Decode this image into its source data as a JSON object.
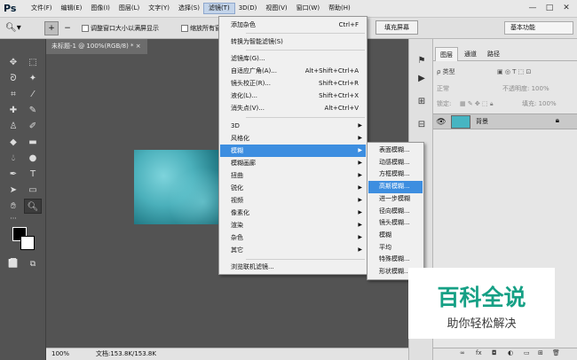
{
  "app": {
    "logo": "Ps"
  },
  "menubar": {
    "items": [
      "文件(F)",
      "编辑(E)",
      "图像(I)",
      "图层(L)",
      "文字(Y)",
      "选择(S)",
      "滤镜(T)",
      "3D(D)",
      "视图(V)",
      "窗口(W)",
      "帮助(H)"
    ],
    "active_item": "滤镜(T)"
  },
  "window_controls": {
    "minimize": "—",
    "maximize": "□",
    "close": "✕"
  },
  "options_bar": {
    "resize_windows_label": "调整窗口大小以满屏显示",
    "zoom_all_windows_label": "缩放所有窗口",
    "fill_screen_button": "填充屏幕",
    "workspace_value": "基本功能"
  },
  "document": {
    "tab_title": "未标题-1 @ 100%(RGB/8) *",
    "zoom_status": "100%",
    "doc_info": "文档:153.8K/153.8K"
  },
  "filter_menu": {
    "items": [
      {
        "label": "添加杂色",
        "shortcut": "Ctrl+F"
      },
      {
        "separator": true
      },
      {
        "label": "转换为智能滤镜(S)"
      },
      {
        "separator": true
      },
      {
        "label": "滤镜库(G)..."
      },
      {
        "label": "自适应广角(A)...",
        "shortcut": "Alt+Shift+Ctrl+A"
      },
      {
        "label": "镜头校正(R)...",
        "shortcut": "Shift+Ctrl+R"
      },
      {
        "label": "液化(L)...",
        "shortcut": "Shift+Ctrl+X"
      },
      {
        "label": "消失点(V)...",
        "shortcut": "Alt+Ctrl+V"
      },
      {
        "separator": true
      },
      {
        "label": "3D",
        "submenu": true
      },
      {
        "label": "风格化",
        "submenu": true
      },
      {
        "label": "模糊",
        "submenu": true,
        "highlighted": true
      },
      {
        "label": "模糊画廊",
        "submenu": true
      },
      {
        "label": "扭曲",
        "submenu": true
      },
      {
        "label": "锐化",
        "submenu": true
      },
      {
        "label": "视频",
        "submenu": true
      },
      {
        "label": "像素化",
        "submenu": true
      },
      {
        "label": "渲染",
        "submenu": true
      },
      {
        "label": "杂色",
        "submenu": true
      },
      {
        "label": "其它",
        "submenu": true
      },
      {
        "separator": true
      },
      {
        "label": "浏览联机滤镜..."
      }
    ]
  },
  "blur_submenu": {
    "items": [
      "表面模糊...",
      "动感模糊...",
      "方框模糊...",
      "高斯模糊...",
      "进一步模糊",
      "径向模糊...",
      "镜头模糊...",
      "模糊",
      "平均",
      "特殊模糊...",
      "形状模糊..."
    ],
    "highlighted_index": 3
  },
  "layers_panel": {
    "tabs": [
      "图层",
      "通道",
      "路径"
    ],
    "active_tab": "图层",
    "kind_filter": "ρ 类型",
    "blend_mode": "正常",
    "opacity_label": "不透明度: 100%",
    "lock_label": "锁定:",
    "fill_label": "填充: 100%",
    "layer_name": "背景",
    "footer_icons": [
      "link-icon",
      "fx-icon",
      "mask-icon",
      "adjustment-icon",
      "group-icon",
      "new-layer-icon",
      "trash-icon"
    ]
  },
  "watermark": {
    "title": "百科全说",
    "subtitle": "助你轻松解决"
  },
  "colors": {
    "menu_highlight": "#3d8ee0",
    "canvas_fill": "#47b5c2",
    "watermark_green": "#16a085"
  }
}
